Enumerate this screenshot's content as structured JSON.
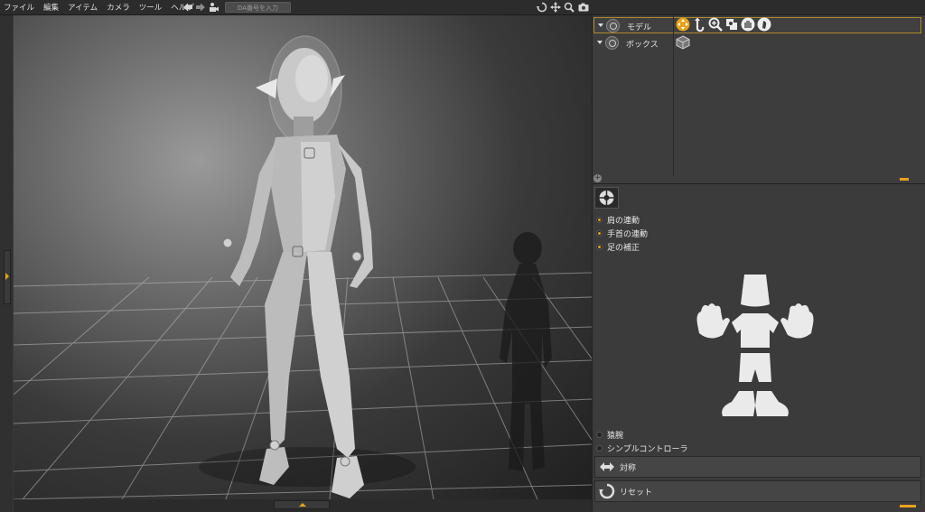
{
  "menu": [
    "ファイル",
    "編集",
    "アイテム",
    "カメラ",
    "ツール",
    "ヘルプ"
  ],
  "search": {
    "placeholder": "DA番号を入力"
  },
  "toolbar_icons": [
    "back-arrow-icon",
    "forward-arrow-icon",
    "camera-person-icon",
    "rotate-icon",
    "move-icon",
    "zoom-icon",
    "camera-icon"
  ],
  "scene": {
    "items": [
      {
        "label": "モデル",
        "selected": true
      },
      {
        "label": "ボックス",
        "selected": false
      }
    ],
    "model_tools": [
      "move-tool-icon",
      "rotate-tool-icon",
      "zoom-tool-icon",
      "pose-tool-icon",
      "hand-tool-icon",
      "foot-tool-icon"
    ]
  },
  "controls": {
    "options_top": [
      {
        "label": "肩の連動",
        "checked": true
      },
      {
        "label": "手首の連動",
        "checked": true
      },
      {
        "label": "足の補正",
        "checked": true
      }
    ],
    "options_bottom": [
      {
        "label": "猿腕",
        "checked": false
      },
      {
        "label": "シンプルコントローラ",
        "checked": false
      }
    ],
    "symmetry_label": "対称",
    "reset_label": "リセット"
  },
  "colors": {
    "accent": "#e8a31c",
    "background": "#3b3b3b",
    "menubar": "#2c2c2c"
  }
}
